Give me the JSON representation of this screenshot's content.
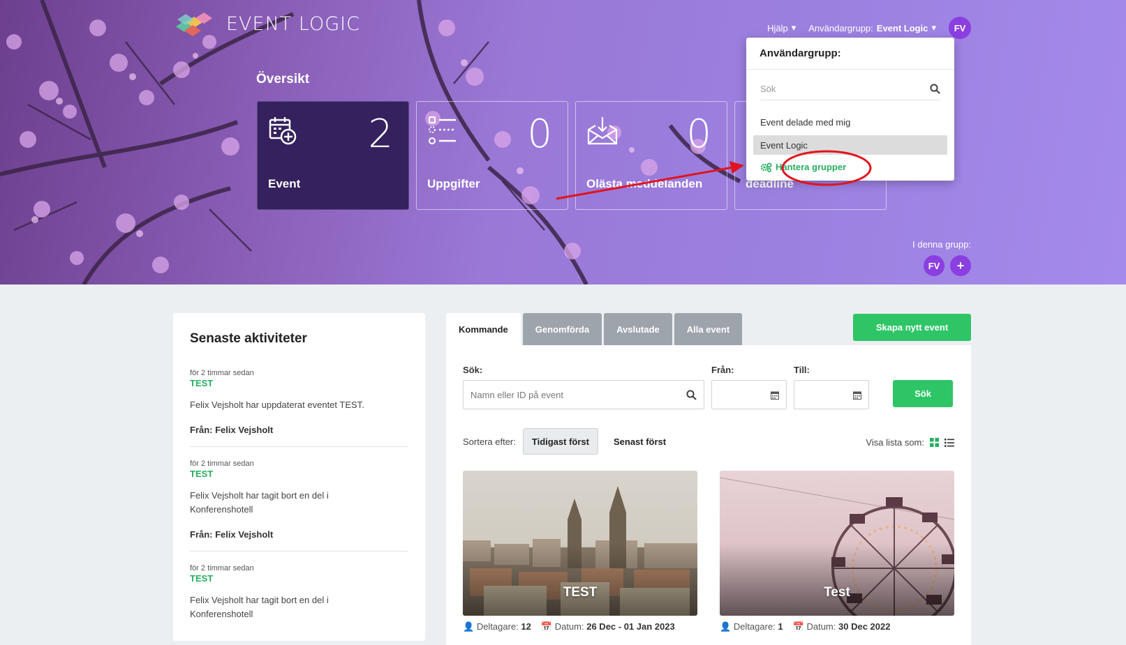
{
  "brand": {
    "name": "EVENT LOGIC"
  },
  "topnav": {
    "help": "Hjälp",
    "group_label": "Användargrupp:",
    "group_value": "Event Logic",
    "avatar": "FV"
  },
  "overview": {
    "title": "Översikt",
    "cards": [
      {
        "label": "Event",
        "count": "2"
      },
      {
        "label": "Uppgifter",
        "count": "0"
      },
      {
        "label": "Olästa meddelanden",
        "count": "0"
      },
      {
        "label": "deadline",
        "count": ""
      }
    ]
  },
  "in_group": {
    "label": "I denna grupp:",
    "avatar": "FV",
    "add": "+"
  },
  "dropdown": {
    "title": "Användargrupp:",
    "search_placeholder": "Sök",
    "items": [
      "Event delade med mig",
      "Event Logic"
    ],
    "manage": "Hantera grupper"
  },
  "activities": {
    "title": "Senaste aktiviteter",
    "items": [
      {
        "time": "för 2 timmar sedan",
        "name": "TEST",
        "desc": "Felix Vejsholt har uppdaterat eventet TEST.",
        "from": "Från: Felix Vejsholt"
      },
      {
        "time": "för 2 timmar sedan",
        "name": "TEST",
        "desc": "Felix Vejsholt har tagit bort en del i Konferenshotell",
        "from": "Från: Felix Vejsholt"
      },
      {
        "time": "för 2 timmar sedan",
        "name": "TEST",
        "desc": "Felix Vejsholt har tagit bort en del i Konferenshotell",
        "from": ""
      }
    ]
  },
  "tabs": [
    "Kommande",
    "Genomförda",
    "Avslutade",
    "Alla event"
  ],
  "create_button": "Skapa nytt event",
  "filters": {
    "search_label": "Sök:",
    "search_placeholder": "Namn eller ID på event",
    "from_label": "Från:",
    "to_label": "Till:",
    "submit": "Sök"
  },
  "sort": {
    "label": "Sortera efter:",
    "earliest": "Tidigast först",
    "latest": "Senast först"
  },
  "view": {
    "label": "Visa lista som:"
  },
  "events": [
    {
      "title": "TEST",
      "participants_label": "Deltagare:",
      "participants": "12",
      "date_label": "Datum:",
      "date": "26 Dec - 01 Jan 2023"
    },
    {
      "title": "Test",
      "participants_label": "Deltagare:",
      "participants": "1",
      "date_label": "Datum:",
      "date": "30 Dec 2022"
    }
  ],
  "colors": {
    "accent_green": "#2ec567",
    "active_card": "#34215d",
    "avatar": "#8b3fe0"
  }
}
